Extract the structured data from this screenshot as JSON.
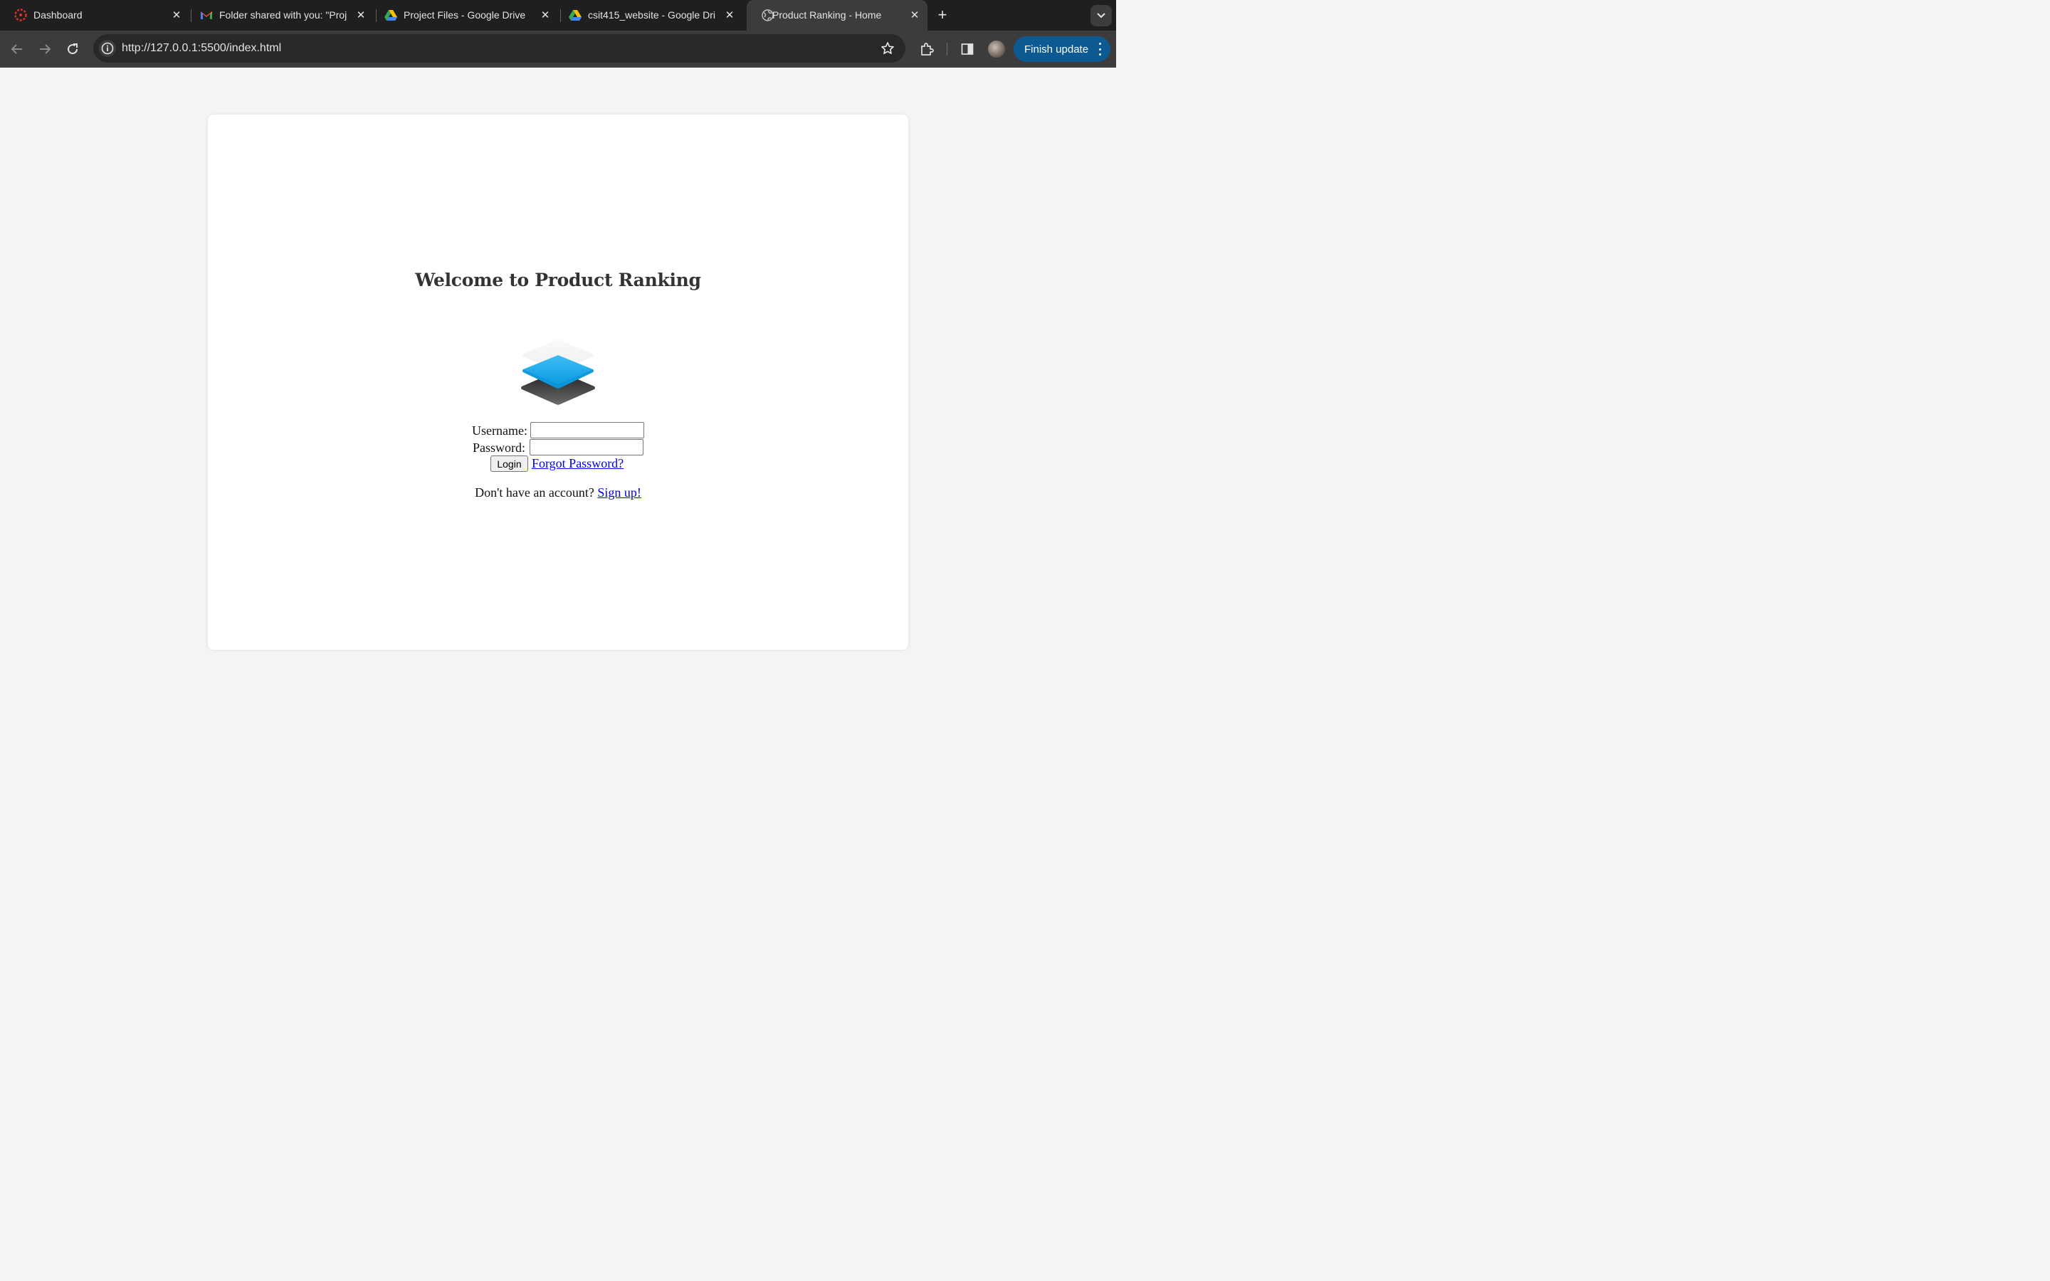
{
  "browser": {
    "tabs": [
      {
        "title": "Dashboard",
        "icon": "canvas-icon"
      },
      {
        "title": "Folder shared with you: \"Proj",
        "icon": "gmail-icon"
      },
      {
        "title": "Project Files - Google Drive",
        "icon": "google-drive-icon"
      },
      {
        "title": "csit415_website - Google Dri",
        "icon": "google-drive-icon"
      },
      {
        "title": "Product Ranking - Home",
        "icon": "globe-icon",
        "active": true
      }
    ],
    "url": "http://127.0.0.1:5500/index.html",
    "update_label": "Finish update",
    "colors": {
      "chrome": "#1f1f1f",
      "toolbar": "#3c3c3c",
      "update_button": "#0c5a91"
    }
  },
  "page": {
    "heading": "Welcome to Product Ranking",
    "logo": "stacked-layers-icon",
    "form": {
      "username_label": "Username:",
      "username_value": "",
      "password_label": "Password:",
      "password_value": "",
      "login_label": "Login",
      "forgot_label": "Forgot Password?"
    },
    "signup": {
      "prompt": "Don't have an account?",
      "link": "Sign up!"
    },
    "colors": {
      "background": "#f4f4f4",
      "card": "#ffffff",
      "link": "#0000ee",
      "logo_accent": "#1aa7ec"
    }
  }
}
